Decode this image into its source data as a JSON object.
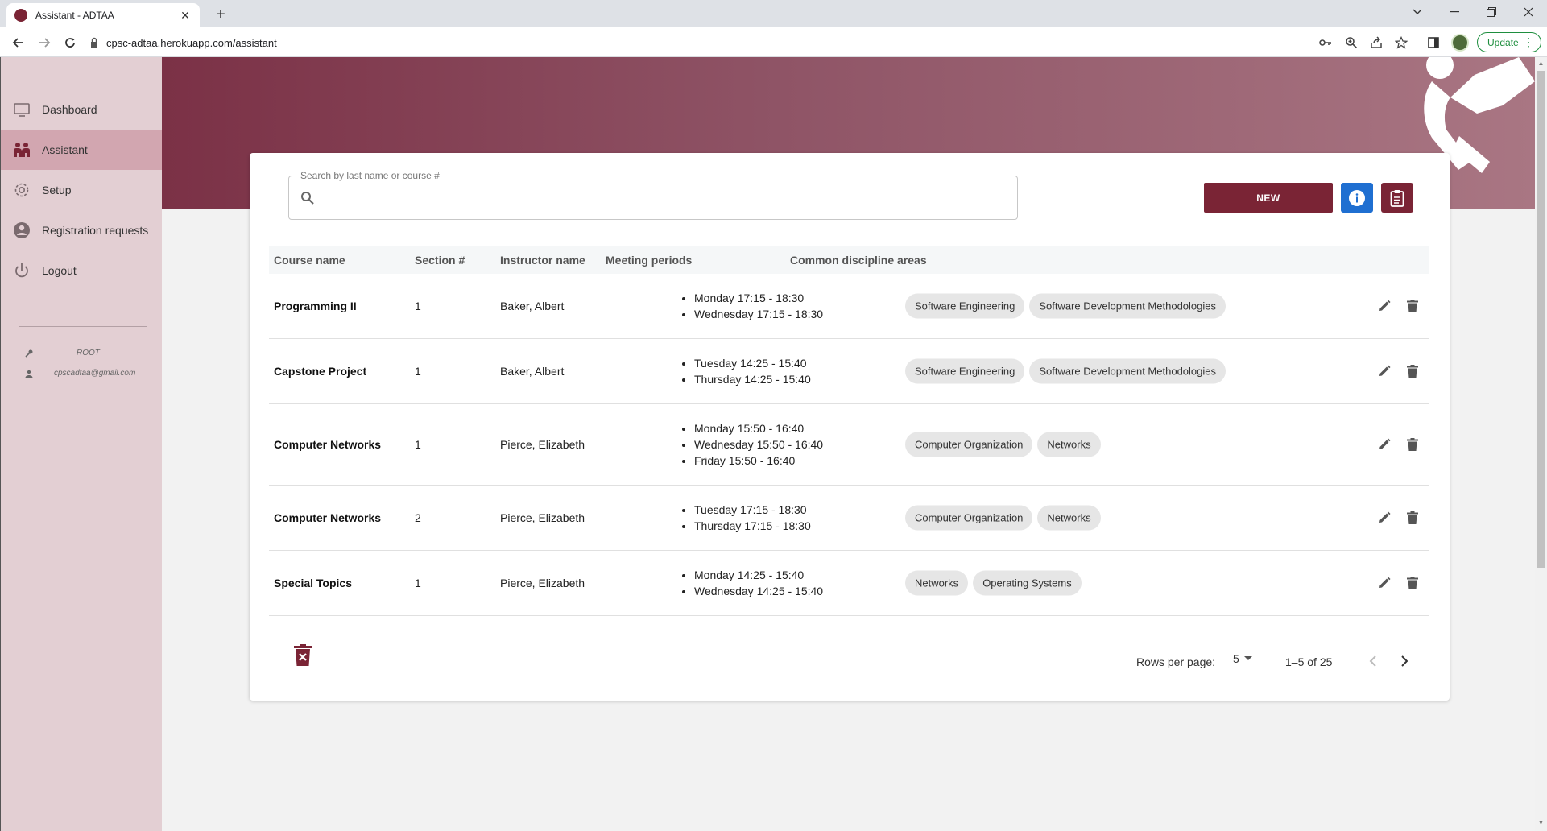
{
  "browser": {
    "tab_title": "Assistant - ADTAA",
    "url": "cpsc-adtaa.herokuapp.com/assistant",
    "update_label": "Update"
  },
  "sidebar": {
    "items": [
      {
        "label": "Dashboard",
        "icon": "monitor-icon",
        "active": false
      },
      {
        "label": "Assistant",
        "icon": "people-icon",
        "active": true
      },
      {
        "label": "Setup",
        "icon": "gear-icon",
        "active": false
      },
      {
        "label": "Registration requests",
        "icon": "account-circle-icon",
        "active": false
      },
      {
        "label": "Logout",
        "icon": "power-icon",
        "active": false
      }
    ],
    "user": {
      "role": "ROOT",
      "email": "cpscadtaa@gmail.com"
    }
  },
  "search": {
    "label": "Search by last name or course #",
    "value": ""
  },
  "actions": {
    "new_label": "NEW"
  },
  "table": {
    "headers": [
      "Course name",
      "Section #",
      "Instructor name",
      "Meeting periods",
      "Common discipline areas"
    ],
    "rows": [
      {
        "course": "Programming II",
        "section": "1",
        "instructor": "Baker, Albert",
        "periods": [
          "Monday 17:15 - 18:30",
          "Wednesday 17:15 - 18:30"
        ],
        "areas": [
          "Software Engineering",
          "Software Development Methodologies"
        ]
      },
      {
        "course": "Capstone Project",
        "section": "1",
        "instructor": "Baker, Albert",
        "periods": [
          "Tuesday 14:25 - 15:40",
          "Thursday 14:25 - 15:40"
        ],
        "areas": [
          "Software Engineering",
          "Software Development Methodologies"
        ]
      },
      {
        "course": "Computer Networks",
        "section": "1",
        "instructor": "Pierce, Elizabeth",
        "periods": [
          "Monday 15:50 - 16:40",
          "Wednesday 15:50 - 16:40",
          "Friday 15:50 - 16:40"
        ],
        "areas": [
          "Computer Organization",
          "Networks"
        ]
      },
      {
        "course": "Computer Networks",
        "section": "2",
        "instructor": "Pierce, Elizabeth",
        "periods": [
          "Tuesday 17:15 - 18:30",
          "Thursday 17:15 - 18:30"
        ],
        "areas": [
          "Computer Organization",
          "Networks"
        ]
      },
      {
        "course": "Special Topics",
        "section": "1",
        "instructor": "Pierce, Elizabeth",
        "periods": [
          "Monday 14:25 - 15:40",
          "Wednesday 14:25 - 15:40"
        ],
        "areas": [
          "Networks",
          "Operating Systems"
        ]
      }
    ]
  },
  "pagination": {
    "rows_per_page_label": "Rows per page:",
    "rows_per_page": "5",
    "range": "1–5 of 25"
  },
  "colors": {
    "brand": "#7a2435",
    "info": "#1f6fd1",
    "sidebar_bg": "#e3cfd3",
    "sidebar_active": "#d2a6b0"
  }
}
